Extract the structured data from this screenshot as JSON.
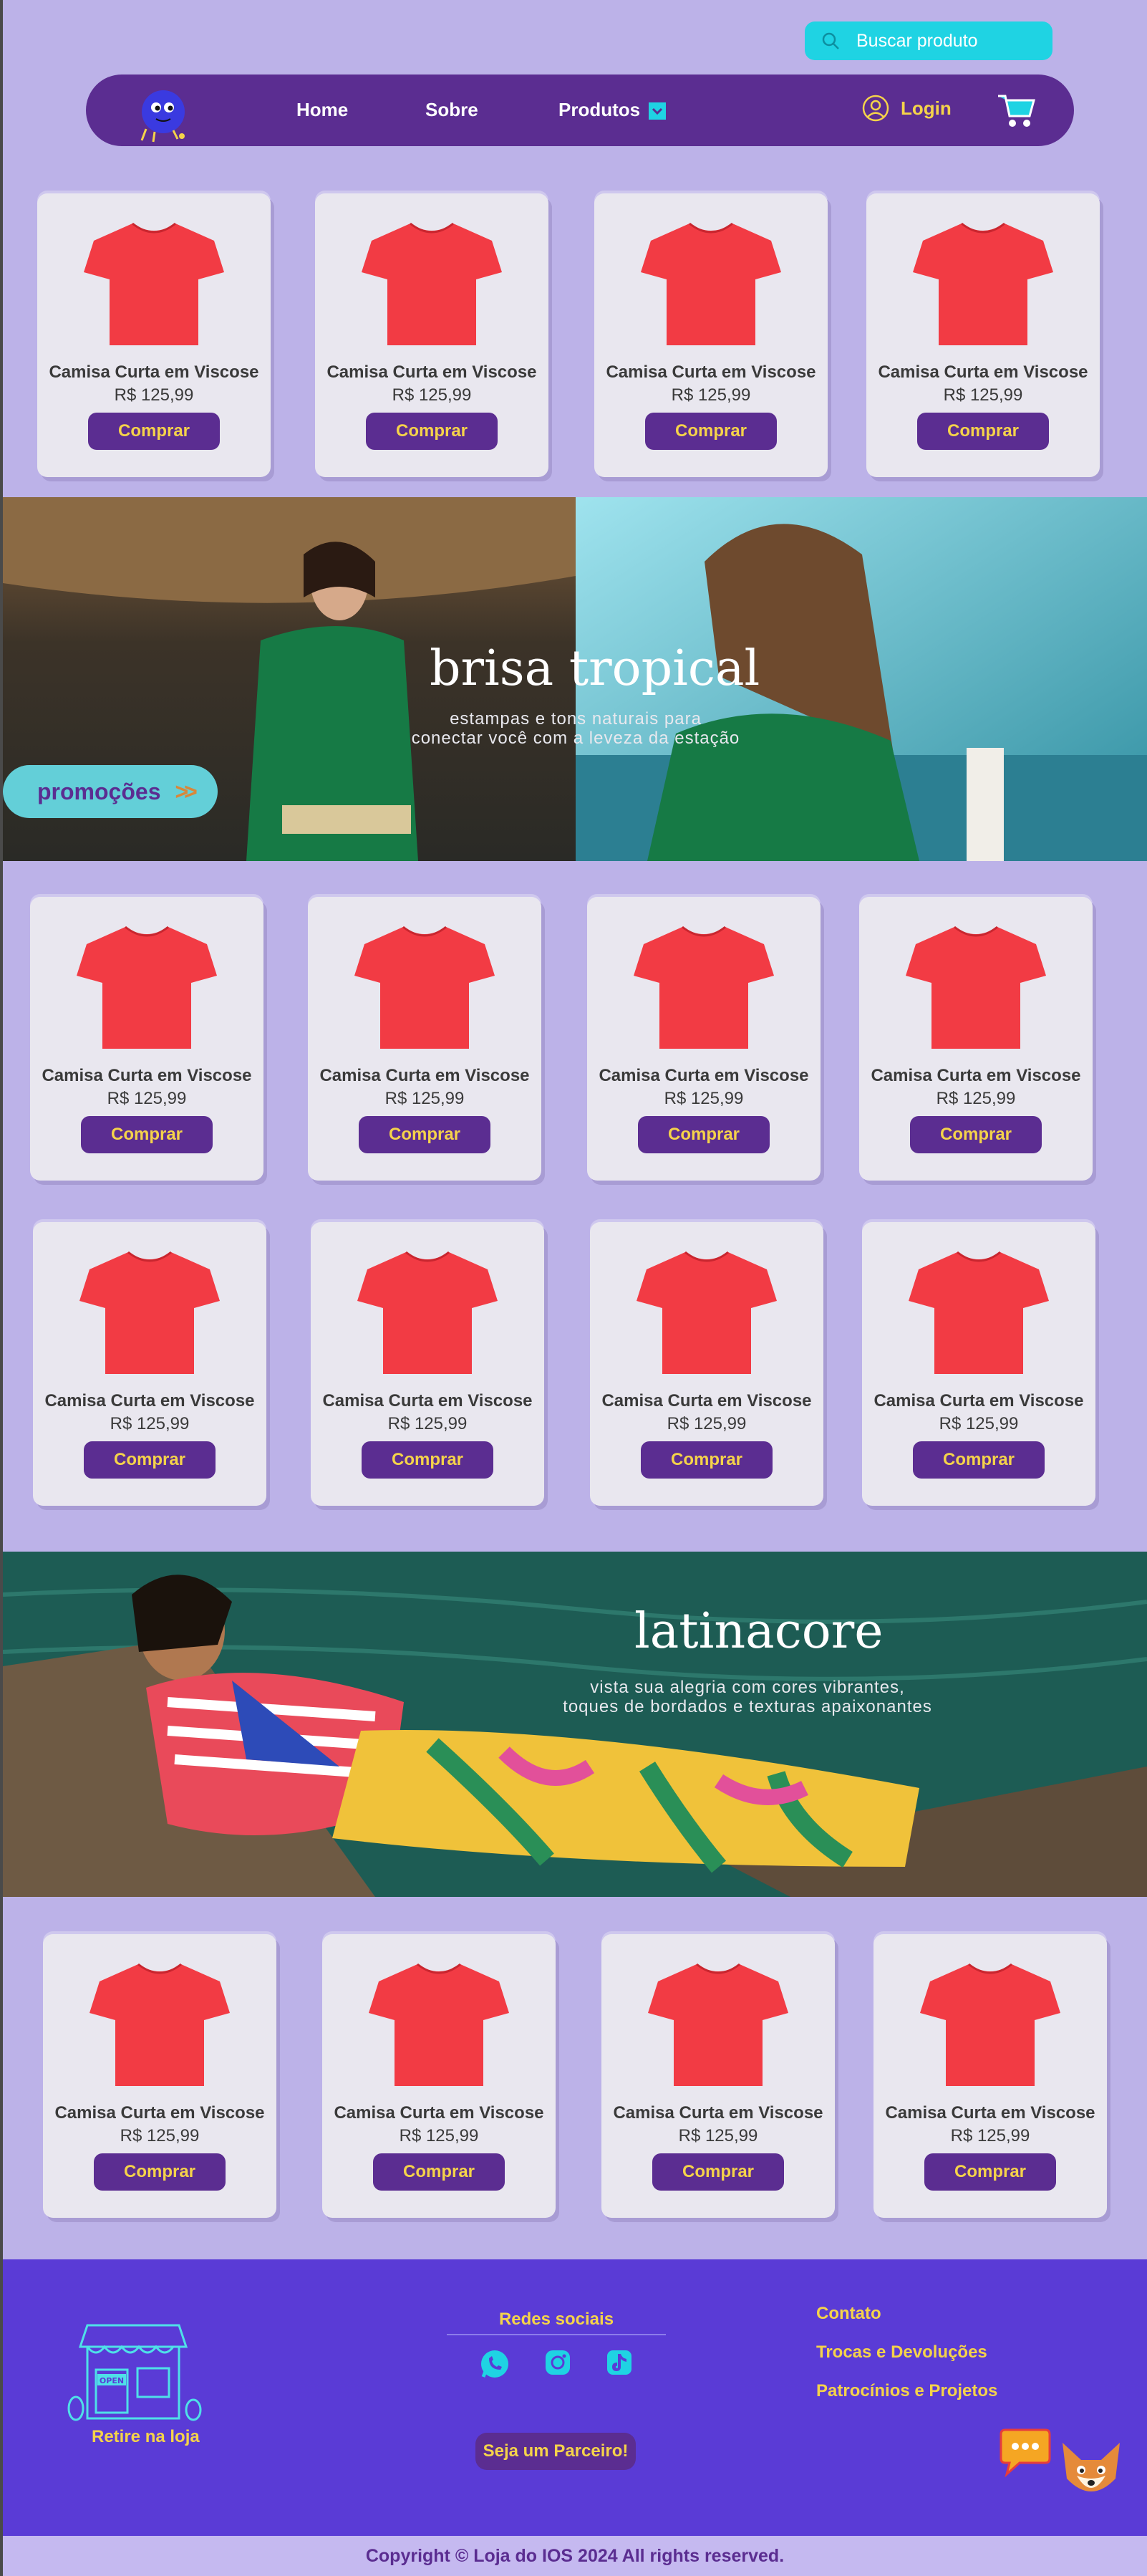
{
  "search": {
    "placeholder": "Buscar produto"
  },
  "nav": {
    "home": "Home",
    "about": "Sobre",
    "products": "Produtos",
    "login": "Login"
  },
  "product": {
    "name": "Camisa Curta em Viscose",
    "price": "R$ 125,99",
    "buy": "Comprar"
  },
  "banner1": {
    "title": "brisa tropical",
    "subtitle_line1": "estampas e tons naturais para",
    "subtitle_line2": "conectar você com a leveza da estação",
    "promo": "promoções",
    "promo_chevrons": ">>"
  },
  "banner2": {
    "title": "latinacore",
    "subtitle_line1": "vista sua alegria com cores vibrantes,",
    "subtitle_line2": "toques de bordados e texturas apaixonantes"
  },
  "footer": {
    "store_pickup": "Retire na loja",
    "store_sign": "OPEN",
    "social_title": "Redes sociais",
    "partner": "Seja um Parceiro!",
    "contact": "Contato",
    "returns": "Trocas e Devoluções",
    "sponsorship": "Patrocínios e Projetos",
    "copyright": "Copyright © Loja do IOS 2024 All rights reserved."
  },
  "colors": {
    "background": "#bcb2e8",
    "nav": "#5b2d91",
    "accent_yellow": "#f5d34a",
    "search": "#1fd3e3",
    "shirt": "#f23b44",
    "footer": "#5a3bd6"
  },
  "icons": [
    "search-icon",
    "user-icon",
    "cart-icon",
    "chevron-down-icon",
    "whatsapp-icon",
    "instagram-icon",
    "tiktok-icon",
    "chat-icon",
    "fox-mascot-icon",
    "store-icon",
    "logo-icon"
  ]
}
